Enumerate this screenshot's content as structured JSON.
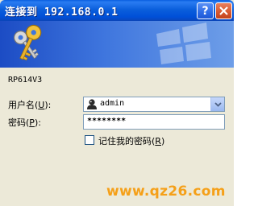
{
  "window": {
    "title": "连接到 192.168.0.1",
    "help_label": "?"
  },
  "banner": {
    "icon": "keys-icon"
  },
  "form": {
    "device_name": "RP614V3",
    "username_label": "用户名",
    "username_key": "U",
    "username_value": "admin",
    "password_label": "密码",
    "password_key": "P",
    "password_value": "********",
    "remember_label": "记住我的密码",
    "remember_key": "R",
    "remember_checked": false
  },
  "watermark": {
    "text": "www.qz26.com"
  },
  "colors": {
    "titlebar": "#0050d8",
    "close_button": "#d85a32",
    "watermark": "#f5a019",
    "dialog_bg": "#ece9d8"
  }
}
